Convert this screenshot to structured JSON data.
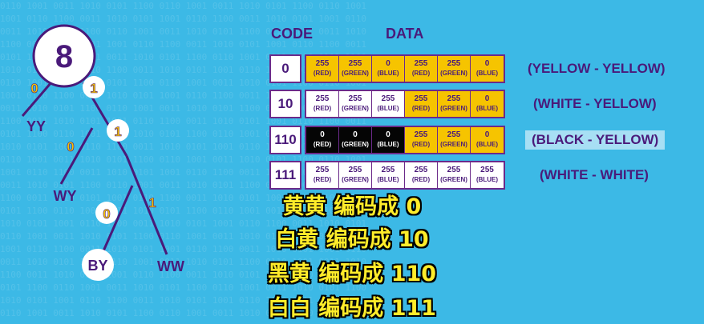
{
  "tree": {
    "root": "8",
    "leaves": [
      "YY",
      "WY",
      "BY",
      "WW"
    ],
    "edge_labels": {
      "root_left": "0",
      "root_right": "1",
      "n1_left": "0",
      "n1_right": "1",
      "n2_left": "0",
      "n2_right": "1"
    }
  },
  "headers": {
    "code": "CODE",
    "data": "DATA"
  },
  "rows": [
    {
      "code": "0",
      "label": "(YELLOW - YELLOW)",
      "highlight": false,
      "cells": [
        {
          "value": "255",
          "channel": "(RED)",
          "fill": "yellow"
        },
        {
          "value": "255",
          "channel": "(GREEN)",
          "fill": "yellow"
        },
        {
          "value": "0",
          "channel": "(BLUE)",
          "fill": "yellow"
        },
        {
          "value": "255",
          "channel": "(RED)",
          "fill": "yellow"
        },
        {
          "value": "255",
          "channel": "(GREEN)",
          "fill": "yellow"
        },
        {
          "value": "0",
          "channel": "(BLUE)",
          "fill": "yellow"
        }
      ]
    },
    {
      "code": "10",
      "label": "(WHITE - YELLOW)",
      "highlight": false,
      "cells": [
        {
          "value": "255",
          "channel": "(RED)",
          "fill": "white"
        },
        {
          "value": "255",
          "channel": "(GREEN)",
          "fill": "white"
        },
        {
          "value": "255",
          "channel": "(BLUE)",
          "fill": "white"
        },
        {
          "value": "255",
          "channel": "(RED)",
          "fill": "yellow"
        },
        {
          "value": "255",
          "channel": "(GREEN)",
          "fill": "yellow"
        },
        {
          "value": "0",
          "channel": "(BLUE)",
          "fill": "yellow"
        }
      ]
    },
    {
      "code": "110",
      "label": "(BLACK - YELLOW)",
      "highlight": true,
      "cells": [
        {
          "value": "0",
          "channel": "(RED)",
          "fill": "black"
        },
        {
          "value": "0",
          "channel": "(GREEN)",
          "fill": "black"
        },
        {
          "value": "0",
          "channel": "(BLUE)",
          "fill": "black"
        },
        {
          "value": "255",
          "channel": "(RED)",
          "fill": "yellow"
        },
        {
          "value": "255",
          "channel": "(GREEN)",
          "fill": "yellow"
        },
        {
          "value": "0",
          "channel": "(BLUE)",
          "fill": "yellow"
        }
      ]
    },
    {
      "code": "111",
      "label": "(WHITE - WHITE)",
      "highlight": false,
      "cells": [
        {
          "value": "255",
          "channel": "(RED)",
          "fill": "white"
        },
        {
          "value": "255",
          "channel": "(GREEN)",
          "fill": "white"
        },
        {
          "value": "255",
          "channel": "(BLUE)",
          "fill": "white"
        },
        {
          "value": "255",
          "channel": "(RED)",
          "fill": "white"
        },
        {
          "value": "255",
          "channel": "(GREEN)",
          "fill": "white"
        },
        {
          "value": "255",
          "channel": "(BLUE)",
          "fill": "white"
        }
      ]
    }
  ],
  "subtitles": [
    "黄黄 编码成 0",
    "白黄 编码成 10",
    "黑黄 编码成 110",
    "白白 编码成 111"
  ],
  "colors": {
    "background": "#3cb9e6",
    "purple": "#4a1a7a",
    "yellow": "#f6c400",
    "subtitle": "#ffec2a"
  }
}
